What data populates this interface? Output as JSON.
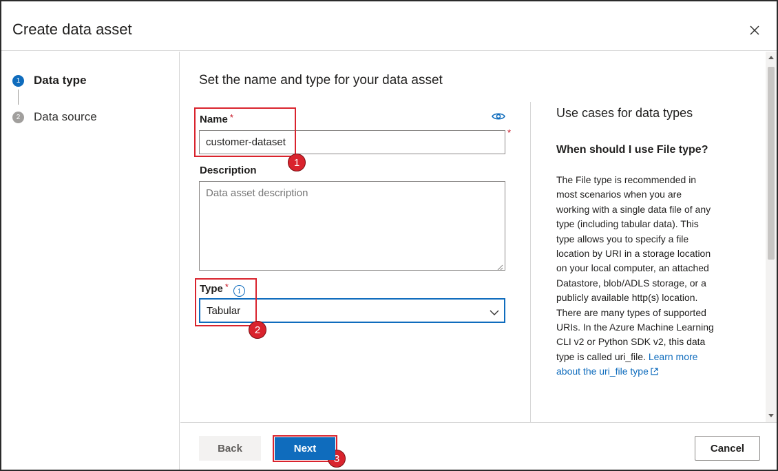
{
  "dialog": {
    "title": "Create data asset",
    "close_icon": "close-icon"
  },
  "steps": [
    {
      "number": "1",
      "label": "Data type",
      "state": "active"
    },
    {
      "number": "2",
      "label": "Data source",
      "state": "inactive"
    }
  ],
  "form": {
    "heading": "Set the name and type for your data asset",
    "name": {
      "label": "Name",
      "required_mark": "*",
      "value": "customer-dataset"
    },
    "description": {
      "label": "Description",
      "placeholder": "Data asset description",
      "value": ""
    },
    "type": {
      "label": "Type",
      "required_mark": "*",
      "info_icon": "info-icon",
      "selected": "Tabular"
    }
  },
  "info_panel": {
    "title": "Use cases for data types",
    "subtitle": "When should I use File type?",
    "body": "The File type is recommended in most scenarios when you are working with a single data file of any type (including tabular data). This type allows you to specify a file location by URI in a storage location on your local computer, an attached Datastore, blob/ADLS storage, or a publicly available http(s) location. There are many types of supported URIs. In the Azure Machine Learning CLI v2 or Python SDK v2, this data type is called uri_file.",
    "link": "Learn more about the uri_file type"
  },
  "footer": {
    "back_label": "Back",
    "next_label": "Next",
    "cancel_label": "Cancel"
  },
  "annotations": {
    "badge_1": "1",
    "badge_2": "2",
    "badge_3": "3"
  },
  "colors": {
    "accent": "#0f6cbd",
    "annotation_red": "#d9232d",
    "required_red": "#c50f1f"
  }
}
